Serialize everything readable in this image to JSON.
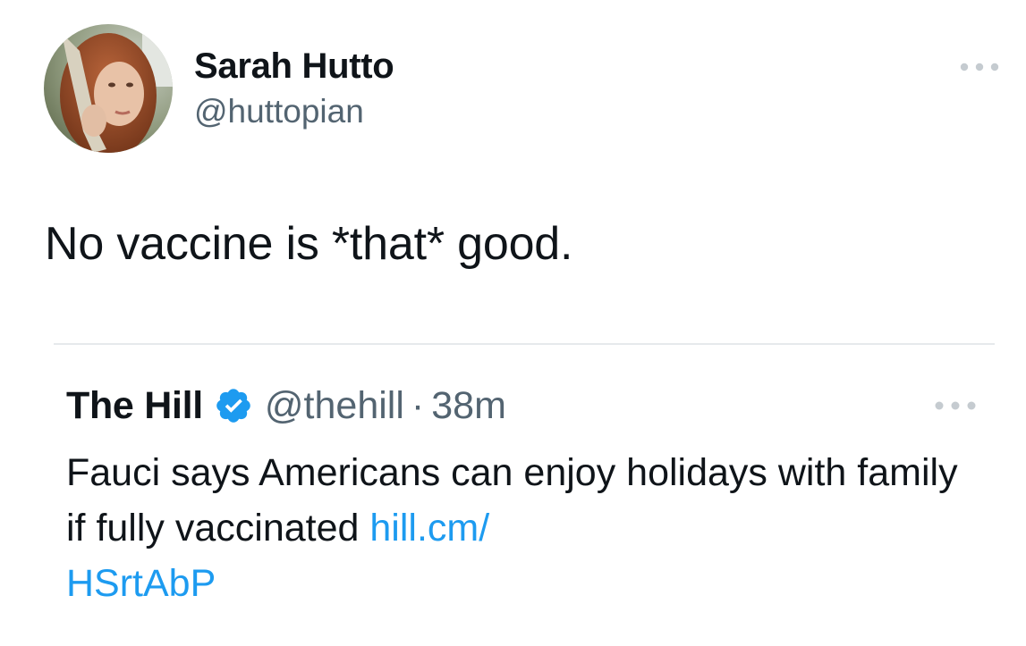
{
  "tweet": {
    "display_name": "Sarah Hutto",
    "handle": "@huttopian",
    "text": "No vaccine is *that* good.",
    "more_icon": "more-horizontal-icon"
  },
  "quote": {
    "display_name": "The Hill",
    "verified_icon": "verified-badge-icon",
    "handle": "@thehill",
    "separator": "·",
    "time": "38m",
    "text": "Fauci says Americans can enjoy holidays with family if fully vaccinated",
    "link_line1": "hill.cm/",
    "link_line2": "HSrtAbP",
    "more_icon": "more-horizontal-icon"
  },
  "colors": {
    "text_primary": "#0f1419",
    "text_secondary": "#536471",
    "link": "#1d9bf0",
    "verified": "#1d9bf0",
    "divider": "#e6e9ec"
  }
}
